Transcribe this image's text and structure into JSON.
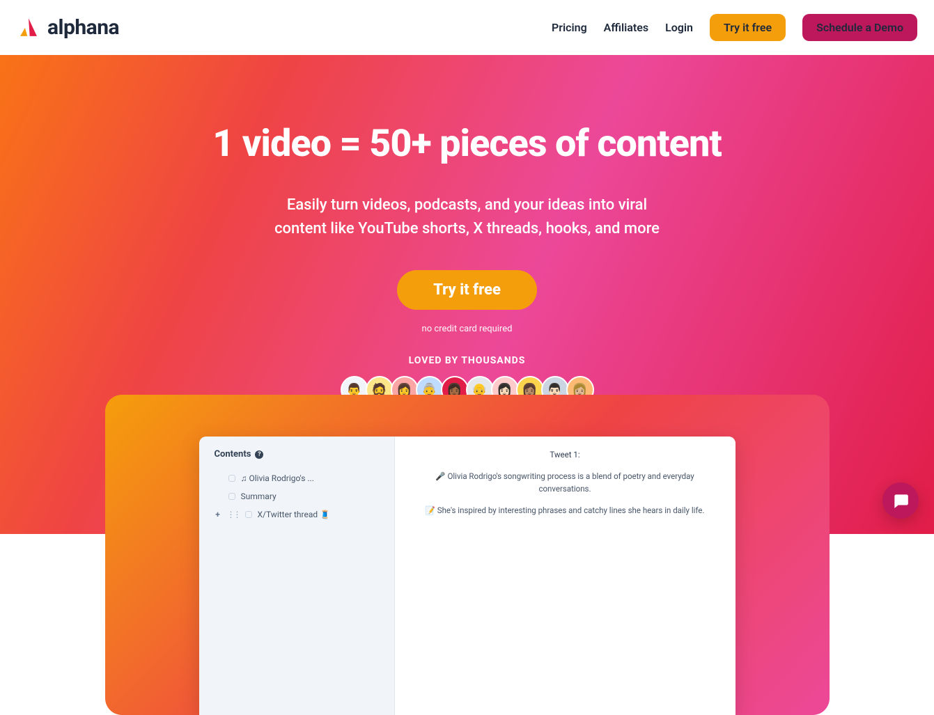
{
  "brand": {
    "name": "alphana"
  },
  "nav": {
    "pricing": "Pricing",
    "affiliates": "Affiliates",
    "login": "Login",
    "try": "Try it free",
    "demo": "Schedule a Demo"
  },
  "hero": {
    "headline": "1 video = 50+ pieces of content",
    "subtitle_line1": "Easily turn videos, podcasts, and your ideas into viral",
    "subtitle_line2": "content like YouTube shorts, X threads, hooks, and more",
    "cta": "Try it free",
    "note": "no credit card required",
    "loved": "LOVED BY THOUSANDS"
  },
  "avatars": [
    "👨",
    "🧔",
    "👩",
    "👵",
    "👩🏾",
    "👴",
    "👩🏻",
    "👩🏽",
    "👨🏻",
    "👩🏼"
  ],
  "preview": {
    "sidebar_title": "Contents",
    "item1": "♫ Olivia Rodrigo's ...",
    "item2": "Summary",
    "item3": "X/Twitter thread 🧵",
    "tweet_heading": "Tweet 1:",
    "tweet_p1": "🎤 Olivia Rodrigo's songwriting process is a blend of poetry and everyday conversations.",
    "tweet_p2": "📝 She's inspired by interesting phrases and catchy lines she hears in daily life."
  },
  "colors": {
    "orange": "#f59e0b",
    "pink": "#be185d"
  }
}
